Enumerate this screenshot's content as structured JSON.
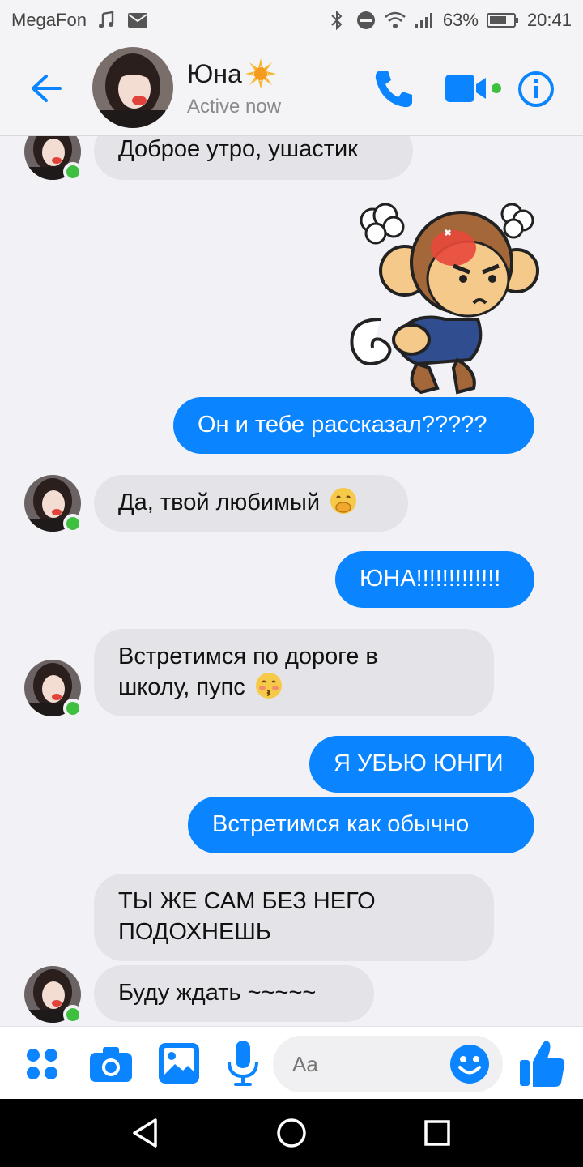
{
  "status_bar": {
    "carrier": "MegaFon",
    "battery": "63%",
    "time": "20:41",
    "icons": [
      "music-note-icon",
      "mail-icon",
      "bluetooth-icon",
      "do-not-disturb-icon",
      "wifi-icon",
      "signal-icon",
      "battery-icon"
    ]
  },
  "header": {
    "name": "Юна",
    "name_emoji": "sun-icon",
    "status": "Active now",
    "colors": {
      "accent": "#0a84ff",
      "online": "#3fbf3f"
    }
  },
  "messages": [
    {
      "side": "in",
      "text": "Доброе утро, ушастик"
    },
    {
      "side": "out",
      "type": "sticker",
      "sticker": "angry-monkey-sticker"
    },
    {
      "side": "out",
      "text": "Он и тебе рассказал?????"
    },
    {
      "side": "in",
      "text": "Да, твой любимый",
      "emoji": "hand-over-mouth-emoji"
    },
    {
      "side": "out",
      "text": "ЮНА!!!!!!!!!!!!!"
    },
    {
      "side": "in",
      "text_line1": "Встретимся по дороге в",
      "text_line2": "школу, пупс",
      "emoji": "kissing-emoji"
    },
    {
      "side": "out",
      "text": "Я УБЬЮ ЮНГИ"
    },
    {
      "side": "out",
      "text": "Встретимся как обычно"
    },
    {
      "side": "in",
      "text_line1": "ТЫ ЖЕ САМ БЕЗ НЕГО",
      "text_line2": "ПОДОХНЕШЬ"
    },
    {
      "side": "in",
      "text": "Буду ждать ~~~~~"
    }
  ],
  "composer": {
    "placeholder": "Aa",
    "icons": [
      "apps-icon",
      "camera-icon",
      "gallery-icon",
      "microphone-icon",
      "emoji-icon",
      "thumbs-up-icon"
    ]
  },
  "navbar": {
    "icons": [
      "back-triangle-icon",
      "home-circle-icon",
      "recents-square-icon"
    ]
  }
}
